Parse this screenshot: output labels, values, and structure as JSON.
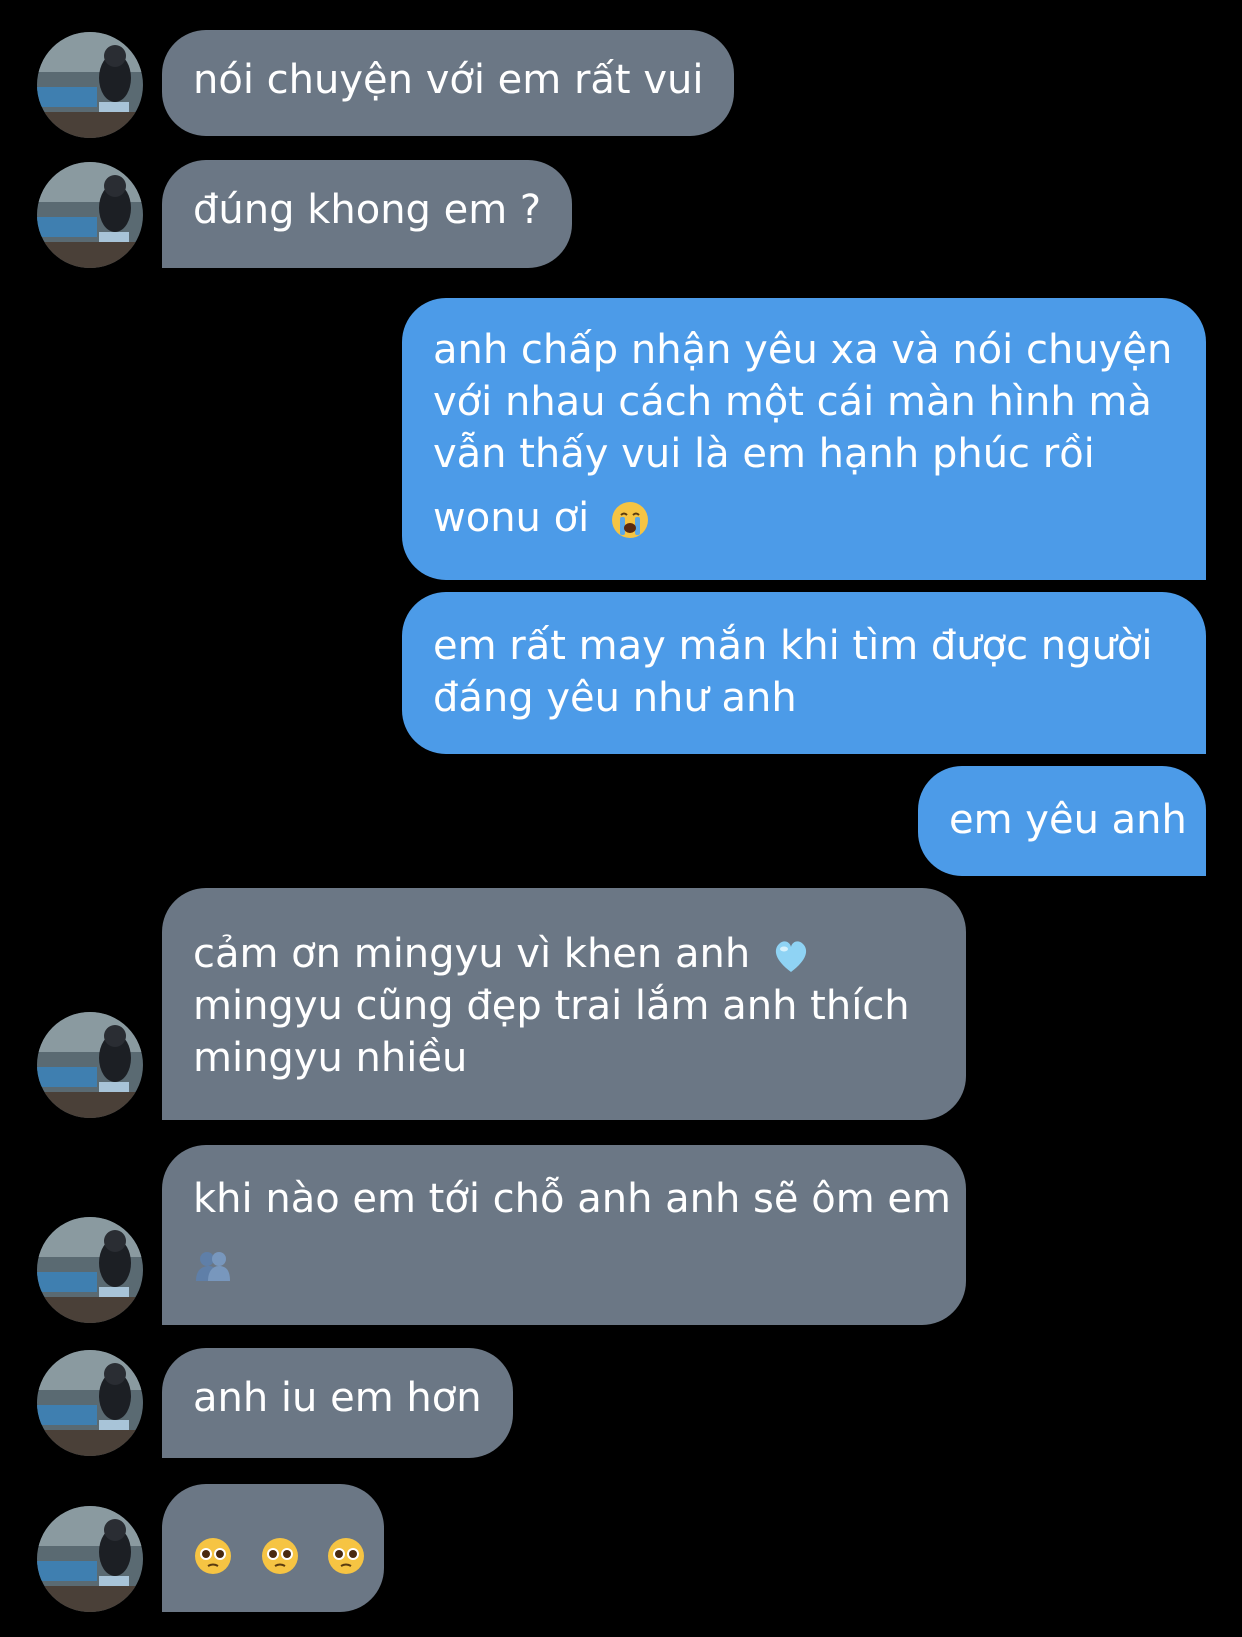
{
  "conversation": {
    "messages": [
      {
        "from": "them",
        "text": "nói chuyện với em rất vui"
      },
      {
        "from": "them",
        "text": "đúng khong em ?"
      },
      {
        "from": "me",
        "lines": [
          "anh chấp nhận yêu xa và nói chuyện",
          "với nhau cách một cái màn hình mà",
          "vẫn thấy vui là em hạnh phúc rồi",
          "wonu ơi"
        ],
        "emoji": "loudly-crying-face-icon"
      },
      {
        "from": "me",
        "lines": [
          "em rất may mắn khi tìm được người",
          "đáng yêu như anh"
        ]
      },
      {
        "from": "me",
        "text": "em yêu anh"
      },
      {
        "from": "them",
        "lines": [
          "cảm ơn mingyu vì khen anh",
          "mingyu cũng đẹp trai lắm anh thích",
          "mingyu nhiều"
        ],
        "emoji": "light-blue-heart-icon"
      },
      {
        "from": "them",
        "lines": [
          "khi nào em tới chỗ anh anh sẽ ôm em"
        ],
        "emoji": "people-hugging-icon"
      },
      {
        "from": "them",
        "text": "anh iu em hơn"
      },
      {
        "from": "them",
        "emojis": [
          "pleading-face-icon",
          "pleading-face-icon",
          "pleading-face-icon"
        ]
      }
    ]
  },
  "colors": {
    "background": "#000000",
    "incoming_bubble": "#6b7785",
    "outgoing_bubble": "#4c9be8",
    "text": "#ffffff"
  }
}
